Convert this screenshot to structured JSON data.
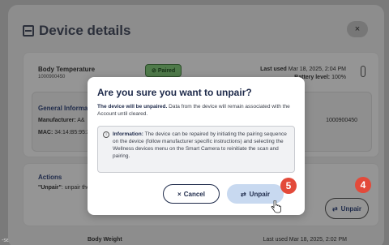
{
  "background": {
    "left_label": "-seri"
  },
  "panel": {
    "title": "Device details",
    "close_label": "×"
  },
  "device": {
    "name": "Body Temperature",
    "id": "1000900450",
    "status": "Paired",
    "last_used_label": "Last used",
    "last_used_value": "Mar 18, 2025, 2:04 PM",
    "battery_label": "Battery level:",
    "battery_value": "100%"
  },
  "general_info": {
    "title": "General Informa",
    "manufacturer_label": "Manufacturer:",
    "manufacturer_value": "A&",
    "mac_label": "MAC:",
    "mac_value": "34:14:B5:95:3",
    "serial_value": "1000900450"
  },
  "actions": {
    "title": "Actions",
    "desc_quote": "\"Unpair\"",
    "desc_rest": ": unpair the",
    "unpair_label": "Unpair"
  },
  "bottom_peek": {
    "name": "Body Weight",
    "last_used": "Last used Mar 18, 2025, 2:02 PM"
  },
  "badges": {
    "step4": "4",
    "step5": "5"
  },
  "modal": {
    "title": "Are you sure you want to unpair?",
    "desc_bold": "The device will be unpaired.",
    "desc_rest": " Data from the device will remain associated with the Account until cleared.",
    "info_bold": "Information:",
    "info_rest": " The device can be repaired by initiating the pairing sequence on the device (follow manufacturer specific instructions) and selecting the Wellness devices menu on the Smart Camera to reinitiate the scan and pairing.",
    "cancel_label": "Cancel",
    "unpair_label": "Unpair"
  }
}
